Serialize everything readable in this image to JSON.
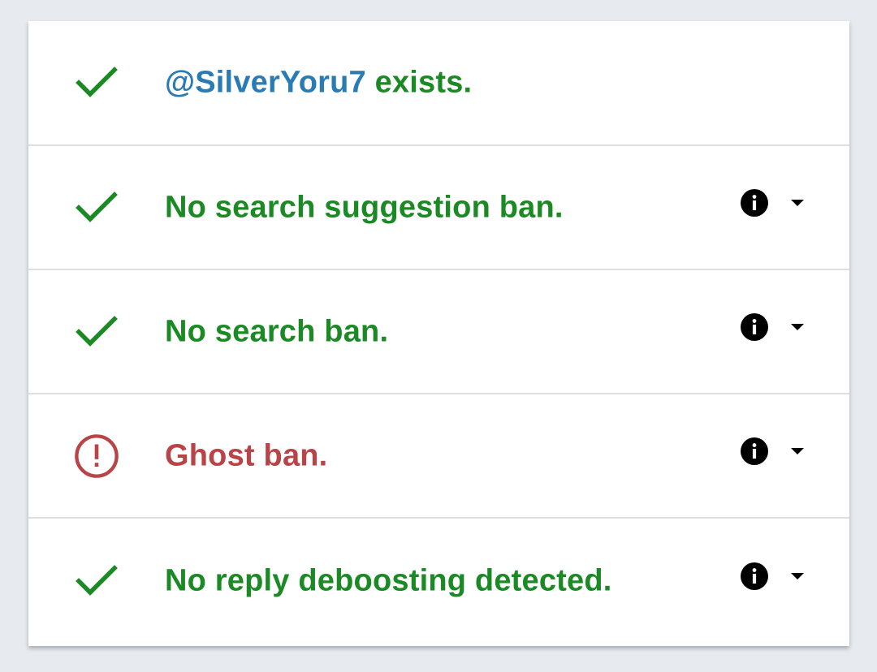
{
  "colors": {
    "ok": "#1b8a24",
    "bad": "#b94448",
    "handle": "#2a7bb4",
    "background": "#e7ebef"
  },
  "rows": [
    {
      "status": "ok",
      "icon": "check-icon",
      "handle": "@SilverYoru7",
      "text": " exists.",
      "has_info": false
    },
    {
      "status": "ok",
      "icon": "check-icon",
      "text": "No search suggestion ban.",
      "has_info": true
    },
    {
      "status": "ok",
      "icon": "check-icon",
      "text": "No search ban.",
      "has_info": true
    },
    {
      "status": "bad",
      "icon": "alert-circle-icon",
      "text": "Ghost ban.",
      "has_info": true
    },
    {
      "status": "ok",
      "icon": "check-icon",
      "text": "No reply deboosting detected.",
      "has_info": true
    }
  ]
}
